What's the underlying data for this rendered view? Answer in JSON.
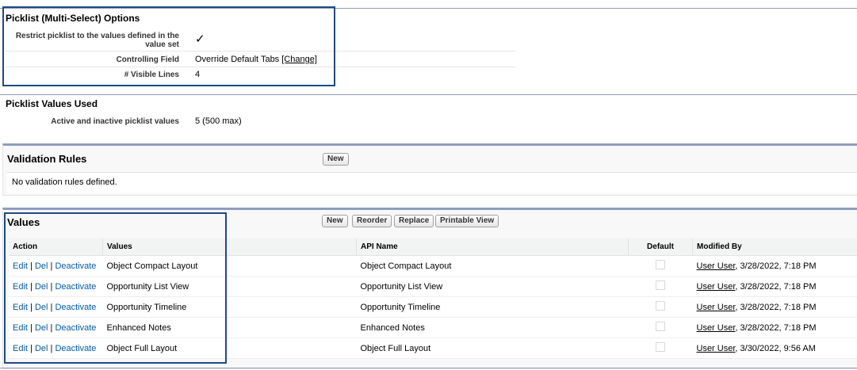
{
  "picklist_options": {
    "title": "Picklist (Multi-Select) Options",
    "restrict_label": "Restrict picklist to the values defined in the value set",
    "restrict_value": "✓",
    "controlling_label": "Controlling Field",
    "controlling_value": "Override Default Tabs",
    "controlling_change": "[Change]",
    "visible_lines_label": "# Visible Lines",
    "visible_lines_value": "4"
  },
  "picklist_values_used": {
    "title": "Picklist Values Used",
    "active_label": "Active and inactive picklist values",
    "active_value": "5 (500 max)"
  },
  "validation_rules": {
    "title": "Validation Rules",
    "new_label": "New",
    "empty_text": "No validation rules defined."
  },
  "values_section": {
    "title": "Values",
    "buttons": [
      "New",
      "Reorder",
      "Replace",
      "Printable View"
    ],
    "columns": [
      "Action",
      "Values",
      "API Name",
      "Default",
      "Modified By"
    ],
    "actions": [
      "Edit",
      "Del",
      "Deactivate"
    ],
    "rows": [
      {
        "value": "Object Compact Layout",
        "api_name": "Object Compact Layout",
        "default": false,
        "modified_user": "User User",
        "modified_date": ", 3/28/2022, 7:18 PM"
      },
      {
        "value": "Opportunity List View",
        "api_name": "Opportunity List View",
        "default": false,
        "modified_user": "User User",
        "modified_date": ", 3/28/2022, 7:18 PM"
      },
      {
        "value": "Opportunity Timeline",
        "api_name": "Opportunity Timeline",
        "default": false,
        "modified_user": "User User",
        "modified_date": ", 3/28/2022, 7:18 PM"
      },
      {
        "value": "Enhanced Notes",
        "api_name": "Enhanced Notes",
        "default": false,
        "modified_user": "User User",
        "modified_date": ", 3/28/2022, 7:18 PM"
      },
      {
        "value": "Object Full Layout",
        "api_name": "Object Full Layout",
        "default": false,
        "modified_user": "User User",
        "modified_date": ", 3/30/2022, 9:56 AM"
      }
    ]
  }
}
